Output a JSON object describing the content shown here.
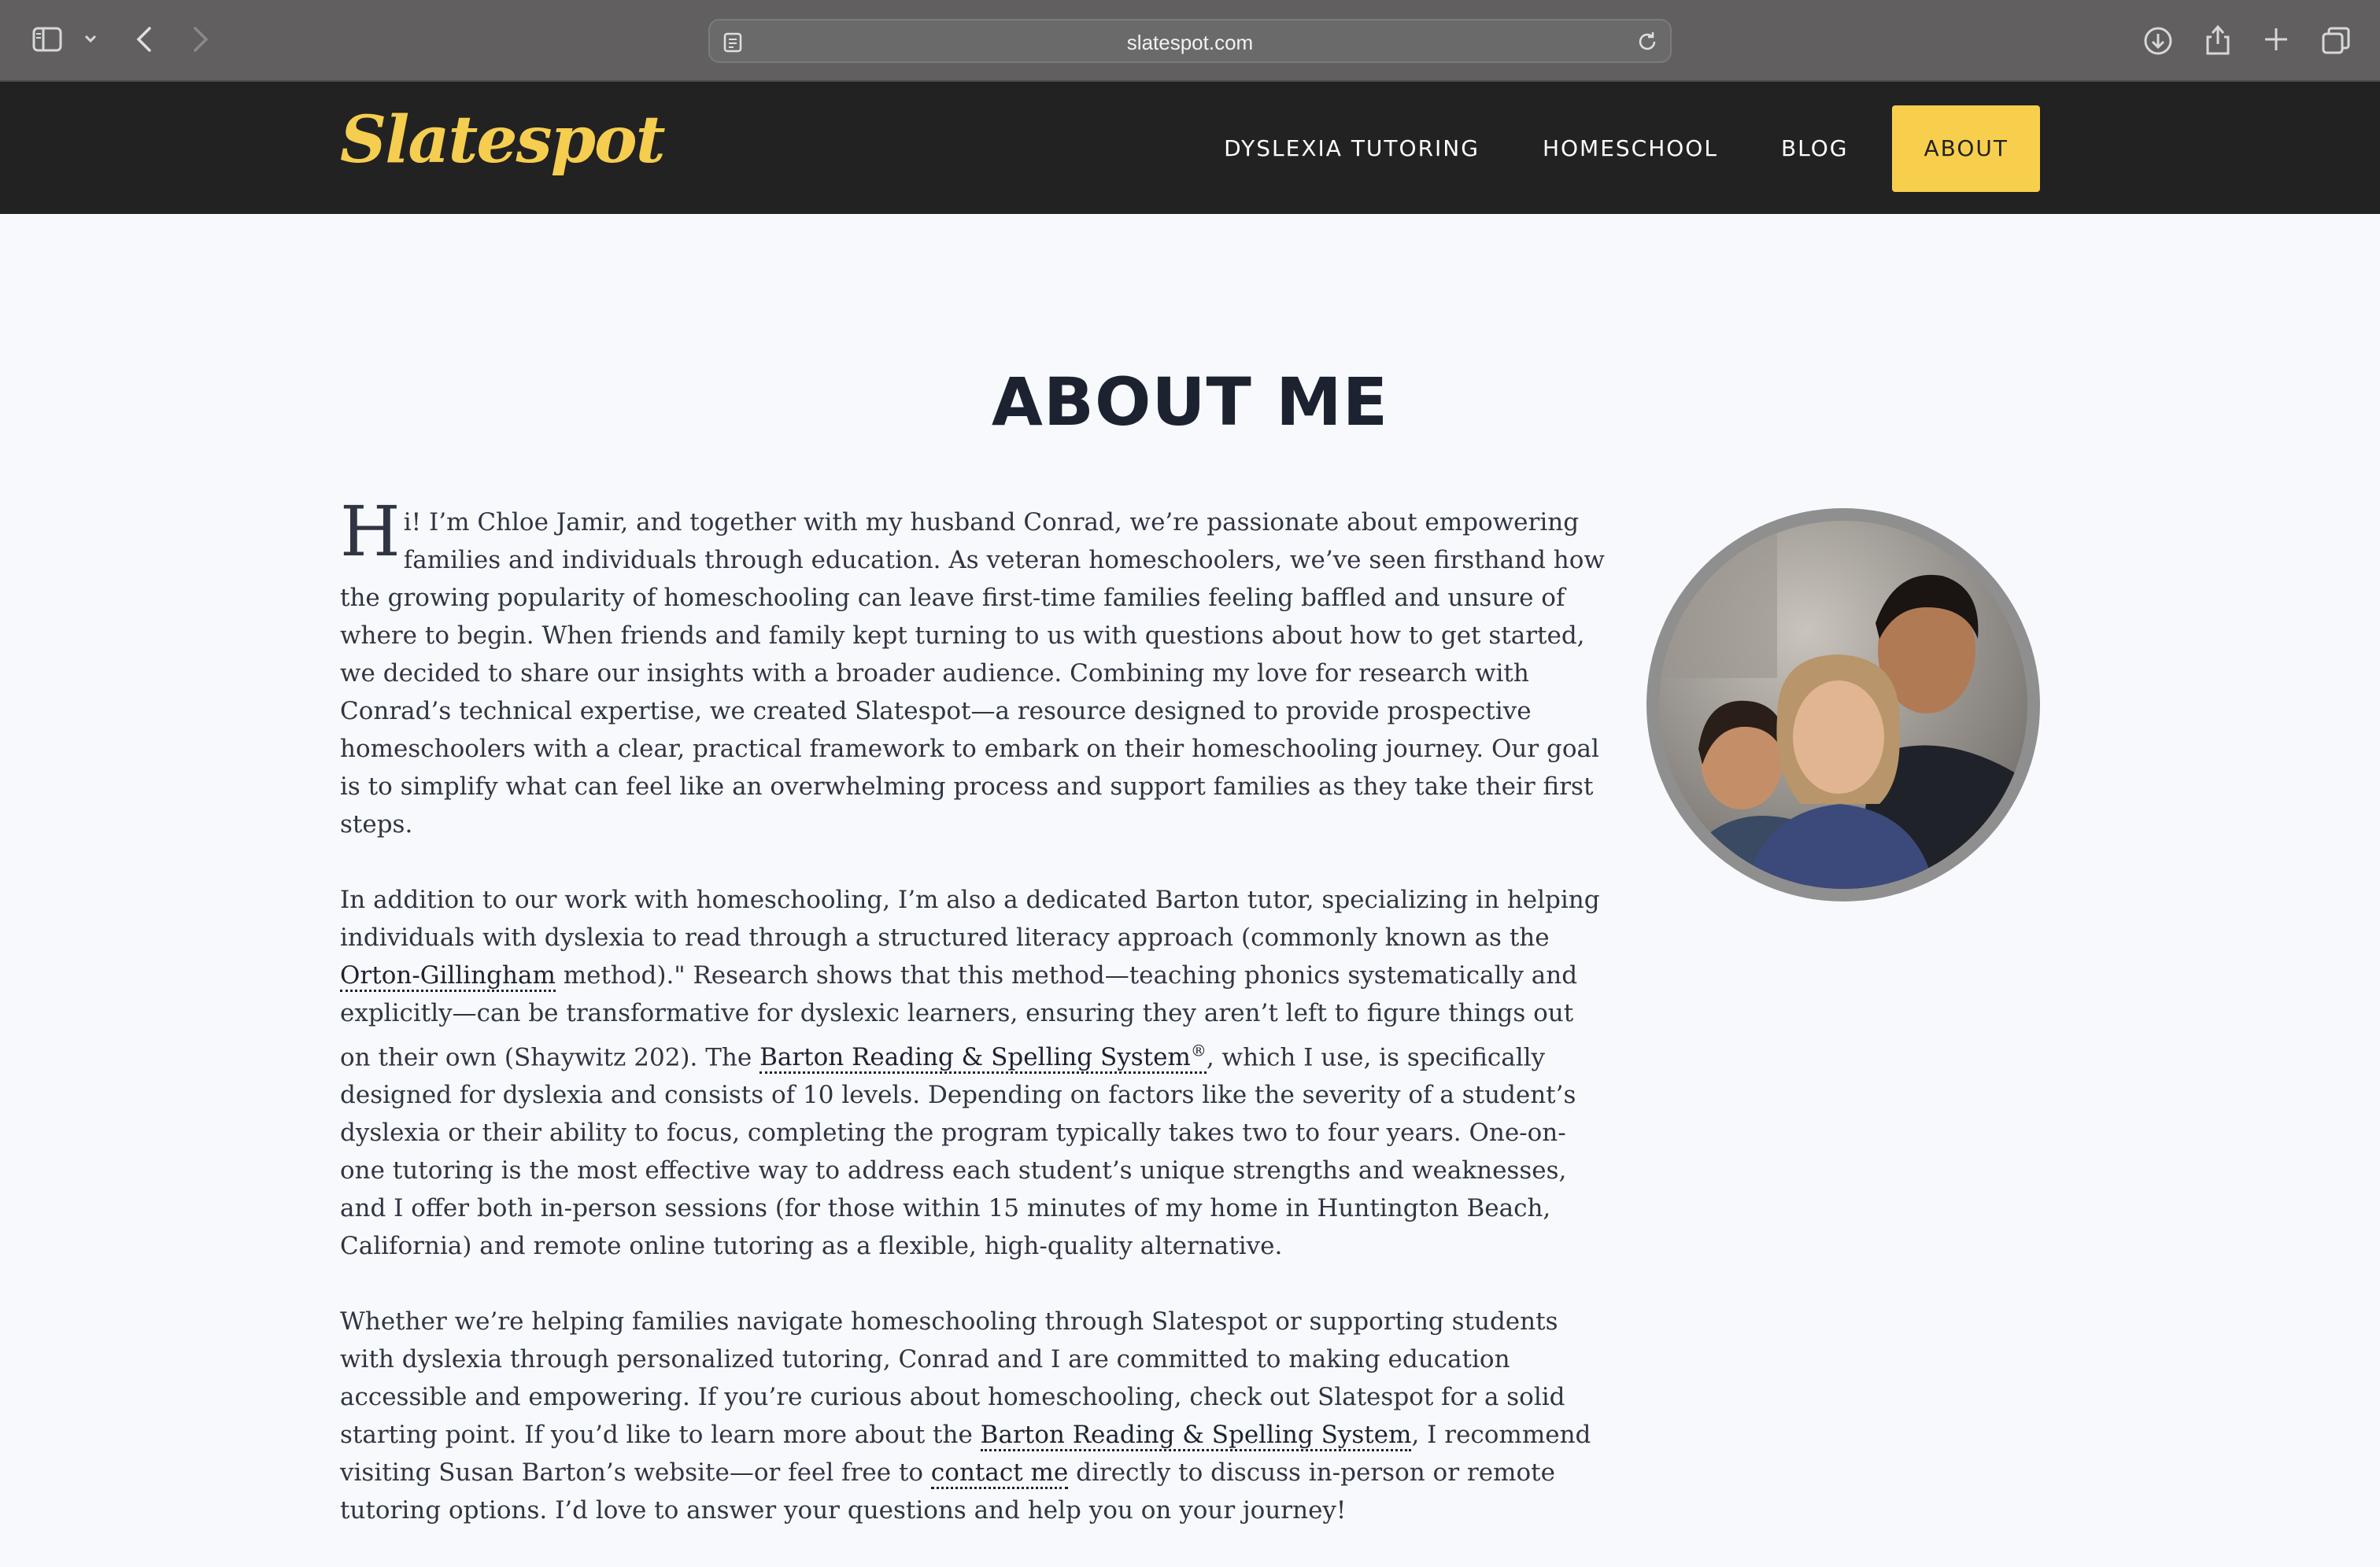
{
  "browser": {
    "url": "slatespot.com",
    "icons": [
      "sidebar-icon",
      "chevron-down-icon",
      "back-icon",
      "forward-icon",
      "reader-icon",
      "reload-icon",
      "download-icon",
      "share-icon",
      "new-tab-icon",
      "tabs-overview-icon"
    ]
  },
  "site": {
    "logo": "Slatespot",
    "nav": [
      {
        "label": "DYSLEXIA TUTORING"
      },
      {
        "label": "HOMESCHOOL"
      },
      {
        "label": "BLOG"
      },
      {
        "label": "ABOUT",
        "active": true
      }
    ],
    "accent_color": "#f8cf4d",
    "header_color": "#222222"
  },
  "main": {
    "title": "ABOUT ME",
    "p1": {
      "dropcap": "H",
      "text": "i! I’m Chloe Jamir, and together with my husband Conrad, we’re passionate about empowering families and individuals through education. As veteran homeschoolers, we’ve seen firsthand how the growing popularity of homeschooling can leave first-time families feeling baffled and unsure of where to begin. When friends and family kept turning to us with questions about how to get started, we decided to share our insights with a broader audience. Combining my love for research with Conrad’s technical expertise, we created Slatespot—a resource designed to provide prospective homeschoolers with a clear, practical framework to embark on their homeschooling journey. Our goal is to simplify what can feel like an overwhelming process and support families as they take their first steps."
    },
    "p2": {
      "t1": "In addition to our work with homeschooling, I’m also a dedicated Barton tutor, specializing in helping individuals with dyslexia to read through a structured literacy approach (commonly known as the ",
      "link1": "Orton-Gillingham",
      "t2": " method).\" Research shows that this method—teaching phonics systematically and explicitly—can be transformative for dyslexic learners, ensuring they aren’t left to figure things out on their own (Shaywitz 202). The ",
      "link2": "Barton Reading & Spelling System",
      "sup": "®",
      "t3": ", which I use, is specifically designed for dyslexia and consists of 10 levels. Depending on factors like the severity of a student’s dyslexia or their ability to focus, completing the program typically takes two to four years. One-on-one tutoring is the most effective way to address each student’s unique strengths and weaknesses, and I offer both in-person sessions (for those within 15 minutes of my home in Huntington Beach, California) and remote online tutoring as a flexible, high-quality alternative."
    },
    "p3": {
      "t1": "Whether we’re helping families navigate homeschooling through Slatespot or supporting students with dyslexia through personalized tutoring, Conrad and I are committed to making education accessible and empowering. If you’re curious about homeschooling, check out Slatespot for a solid starting point. If you’d like to learn more about the ",
      "link1": "Barton Reading & Spelling System",
      "t2": ", I recommend visiting Susan Barton’s website—or feel free to ",
      "link2": "contact me",
      "t3": " directly to discuss in-person or remote tutoring options. I’d love to answer your questions and help you on your journey!"
    }
  }
}
